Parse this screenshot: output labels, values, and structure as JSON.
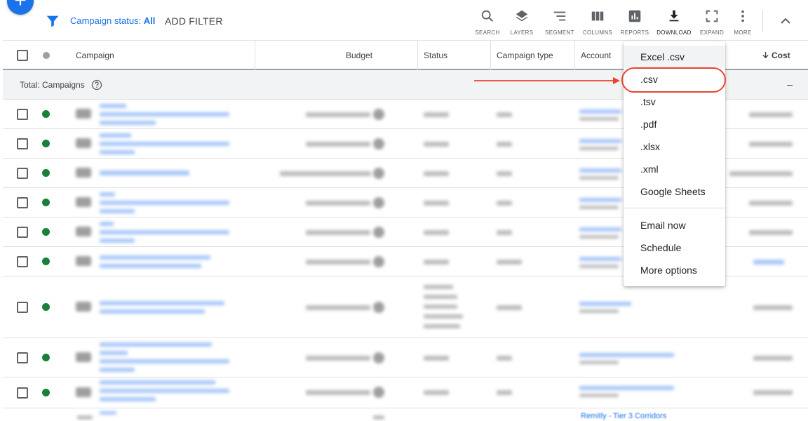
{
  "toolbar": {
    "filter_label_prefix": "Campaign status:",
    "filter_label_value": "All",
    "add_filter": "ADD FILTER",
    "tools": [
      {
        "label": "SEARCH",
        "icon": "search-icon"
      },
      {
        "label": "LAYERS",
        "icon": "layers-icon"
      },
      {
        "label": "SEGMENT",
        "icon": "segment-icon"
      },
      {
        "label": "COLUMNS",
        "icon": "columns-icon"
      },
      {
        "label": "REPORTS",
        "icon": "reports-icon"
      },
      {
        "label": "DOWNLOAD",
        "icon": "download-icon"
      },
      {
        "label": "EXPAND",
        "icon": "expand-icon"
      },
      {
        "label": "MORE",
        "icon": "more-vert-icon"
      }
    ]
  },
  "table": {
    "headers": {
      "campaign": "Campaign",
      "budget": "Budget",
      "status": "Status",
      "campaign_type": "Campaign type",
      "account": "Account",
      "cost": "Cost"
    },
    "total_label": "Total: Campaigns",
    "total_cost": "–",
    "bottom_account_text": "Remitly - Tier 3 Corridors"
  },
  "download_menu": {
    "items": [
      "Excel .csv",
      ".csv",
      ".tsv",
      ".pdf",
      ".xlsx",
      ".xml",
      "Google Sheets"
    ],
    "actions": [
      "Email now",
      "Schedule",
      "More options"
    ]
  },
  "colors": {
    "accent": "#1a73e8",
    "status_enabled": "#188038",
    "annotation": "#e8442e"
  }
}
